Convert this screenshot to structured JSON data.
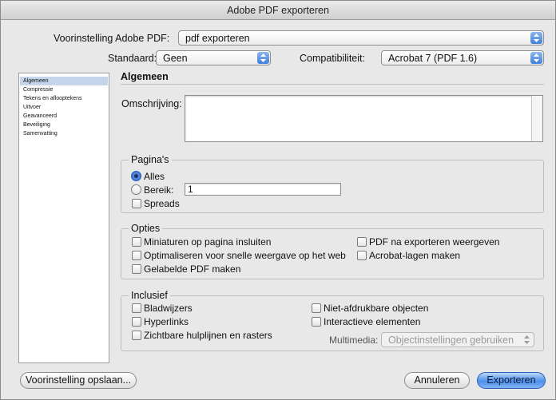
{
  "window": {
    "title": "Adobe PDF exporteren"
  },
  "preset": {
    "label": "Voorinstelling Adobe PDF:",
    "value": "pdf exporteren"
  },
  "standard": {
    "label": "Standaard:",
    "value": "Geen"
  },
  "compat": {
    "label": "Compatibiliteit:",
    "value": "Acrobat 7 (PDF 1.6)"
  },
  "sidebar": {
    "items": [
      {
        "label": "Algemeen",
        "selected": true
      },
      {
        "label": "Compressie"
      },
      {
        "label": "Tekens en aflooptekens"
      },
      {
        "label": "Uitvoer"
      },
      {
        "label": "Geavanceerd"
      },
      {
        "label": "Beveiliging"
      },
      {
        "label": "Samenvatting"
      }
    ]
  },
  "general": {
    "heading": "Algemeen",
    "description_label": "Omschrijving:",
    "description_value": ""
  },
  "pages": {
    "title": "Pagina's",
    "all_label": "Alles",
    "all_selected": true,
    "range_label": "Bereik:",
    "range_value": "1",
    "spreads_label": "Spreads"
  },
  "options": {
    "title": "Opties",
    "thumbnails": "Miniaturen op pagina insluiten",
    "optimize": "Optimaliseren voor snelle weergave op het web",
    "tagged": "Gelabelde PDF maken",
    "view_after": "PDF na exporteren weergeven",
    "acrobat_layers": "Acrobat-lagen maken"
  },
  "include": {
    "title": "Inclusief",
    "bookmarks": "Bladwijzers",
    "hyperlinks": "Hyperlinks",
    "guides": "Zichtbare hulplijnen en rasters",
    "nonprinting": "Niet-afdrukbare objecten",
    "interactive": "Interactieve elementen",
    "multimedia_label": "Multimedia:",
    "multimedia_value": "Objectinstellingen gebruiken"
  },
  "buttons": {
    "save_preset": "Voorinstelling opslaan...",
    "cancel": "Annuleren",
    "export": "Exporteren"
  },
  "colors": {
    "accent": "#3f80dd",
    "selection": "#c5d5ec"
  }
}
